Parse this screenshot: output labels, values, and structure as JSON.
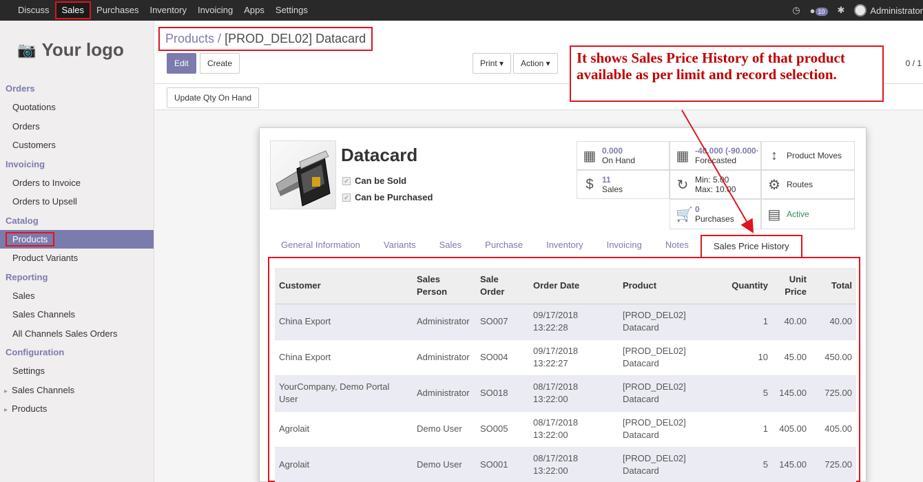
{
  "topbar": {
    "menu": [
      "Discuss",
      "Sales",
      "Purchases",
      "Inventory",
      "Invoicing",
      "Apps",
      "Settings"
    ],
    "active": "Sales",
    "badge": "10",
    "user": "Administrator"
  },
  "sidebar": {
    "logo": "Your logo",
    "sections": [
      {
        "title": "Orders",
        "items": [
          "Quotations",
          "Orders",
          "Customers"
        ]
      },
      {
        "title": "Invoicing",
        "items": [
          "Orders to Invoice",
          "Orders to Upsell"
        ]
      },
      {
        "title": "Catalog",
        "items": [
          "Products",
          "Product Variants"
        ]
      },
      {
        "title": "Reporting",
        "items": [
          "Sales",
          "Sales Channels",
          "All Channels Sales Orders"
        ]
      },
      {
        "title": "Configuration",
        "items": [
          "Settings",
          "Sales Channels",
          "Products"
        ]
      }
    ],
    "active_item": "Products"
  },
  "breadcrumb": {
    "parent": "Products /",
    "current": "[PROD_DEL02] Datacard"
  },
  "buttons": {
    "edit": "Edit",
    "create": "Create",
    "print": "Print ▾",
    "action": "Action ▾",
    "update_qty": "Update Qty On Hand"
  },
  "pager": "0 / 1",
  "annotation": "It shows Sales Price History of that product available as per limit and record selection.",
  "product": {
    "name": "Datacard",
    "can_be_sold": "Can be Sold",
    "can_be_purchased": "Can be Purchased"
  },
  "stats": {
    "on_hand_val": "0.000",
    "on_hand_lbl": "On Hand",
    "forecast_val": "-40.000 (-90.000·",
    "forecast_lbl": "Forecasted",
    "moves": "Product Moves",
    "sales_val": "11",
    "sales_lbl": "Sales",
    "minmax_min": "Min: 5.00",
    "minmax_max": "Max: 10.00",
    "routes": "Routes",
    "purchases_val": "0",
    "purchases_lbl": "Purchases",
    "active": "Active"
  },
  "tabs": [
    "General Information",
    "Variants",
    "Sales",
    "Purchase",
    "Inventory",
    "Invoicing",
    "Notes",
    "Sales Price History"
  ],
  "table": {
    "headers": [
      "Customer",
      "Sales Person",
      "Sale Order",
      "Order Date",
      "Product",
      "Quantity",
      "Unit Price",
      "Total"
    ],
    "rows": [
      [
        "China Export",
        "Administrator",
        "SO007",
        "09/17/2018 13:22:28",
        "[PROD_DEL02] Datacard",
        "1",
        "40.00",
        "40.00"
      ],
      [
        "China Export",
        "Administrator",
        "SO004",
        "09/17/2018 13:22:27",
        "[PROD_DEL02] Datacard",
        "10",
        "45.00",
        "450.00"
      ],
      [
        "YourCompany, Demo Portal User",
        "Administrator",
        "SO018",
        "08/17/2018 13:22:00",
        "[PROD_DEL02] Datacard",
        "5",
        "145.00",
        "725.00"
      ],
      [
        "Agrolait",
        "Demo User",
        "SO005",
        "08/17/2018 13:22:00",
        "[PROD_DEL02] Datacard",
        "1",
        "405.00",
        "405.00"
      ],
      [
        "Agrolait",
        "Demo User",
        "SO001",
        "08/17/2018 13:22:00",
        "[PROD_DEL02] Datacard",
        "5",
        "145.00",
        "725.00"
      ]
    ]
  }
}
